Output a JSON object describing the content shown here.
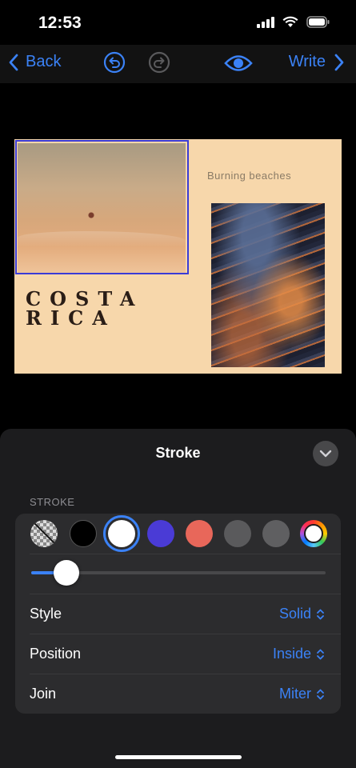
{
  "status_bar": {
    "time": "12:53"
  },
  "nav": {
    "back_label": "Back",
    "write_label": "Write"
  },
  "slide": {
    "subtitle": "Burning beaches",
    "title_line1": "COSTA",
    "title_line2": "RICA"
  },
  "sheet": {
    "title": "Stroke",
    "section_label": "STROKE",
    "swatches": [
      {
        "name": "none",
        "color": "transparent"
      },
      {
        "name": "black",
        "color": "#000000"
      },
      {
        "name": "white",
        "color": "#ffffff",
        "selected": true
      },
      {
        "name": "indigo",
        "color": "#4a3bd6"
      },
      {
        "name": "coral",
        "color": "#e8675a"
      },
      {
        "name": "gray-1",
        "color": "#5a5a5c"
      },
      {
        "name": "gray-2",
        "color": "#5f5f61"
      },
      {
        "name": "custom",
        "color": "rainbow"
      }
    ],
    "stroke_width_fraction": 0.12,
    "rows": {
      "style": {
        "label": "Style",
        "value": "Solid"
      },
      "position": {
        "label": "Position",
        "value": "Inside"
      },
      "join": {
        "label": "Join",
        "value": "Miter"
      }
    }
  },
  "colors": {
    "accent": "#3b82f6",
    "sheet_bg": "#1c1c1e",
    "slide_bg": "#f7d7ab"
  }
}
